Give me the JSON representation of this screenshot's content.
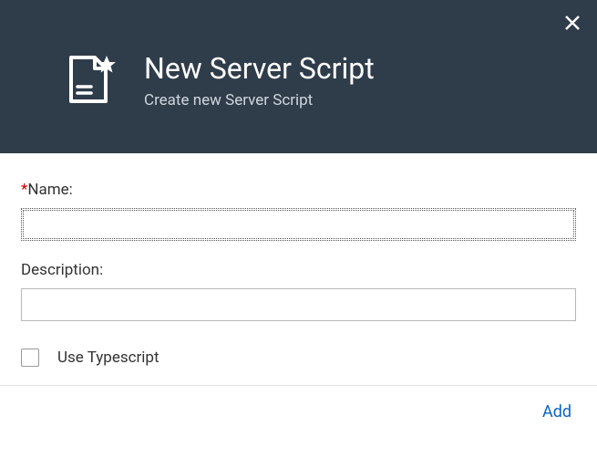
{
  "header": {
    "title": "New Server Script",
    "subtitle": "Create new Server Script"
  },
  "form": {
    "name_label": "Name:",
    "name_value": "",
    "description_label": "Description:",
    "description_value": "",
    "use_typescript_label": "Use Typescript",
    "use_typescript_checked": false
  },
  "footer": {
    "add_label": "Add"
  }
}
